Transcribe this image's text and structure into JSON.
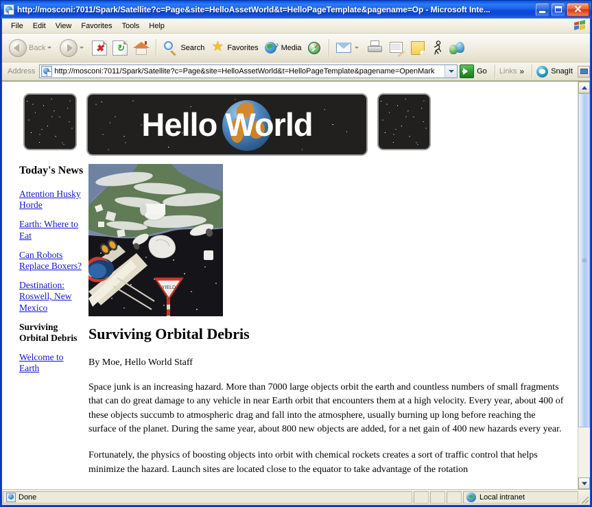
{
  "window": {
    "title": "http://mosconi:7011/Spark/Satellite?c=Page&site=HelloAssetWorld&t=HelloPageTemplate&pagename=Op - Microsoft Inte...",
    "minimize_label": "Minimize",
    "maximize_label": "Maximize",
    "close_label": "✕"
  },
  "menu": {
    "items": [
      {
        "label": "File"
      },
      {
        "label": "Edit"
      },
      {
        "label": "View"
      },
      {
        "label": "Favorites"
      },
      {
        "label": "Tools"
      },
      {
        "label": "Help"
      }
    ]
  },
  "toolbar": {
    "back_label": "Back",
    "forward_label": "",
    "stop_label": "",
    "refresh_label": "",
    "home_label": "",
    "search_label": "Search",
    "favorites_label": "Favorites",
    "media_label": "Media",
    "history_label": "",
    "mail_label": "",
    "print_label": "",
    "edit_label": "",
    "notes_label": "",
    "messenger_label": "",
    "discuss_label": ""
  },
  "address": {
    "label": "Address",
    "url": "http://mosconi:7011/Spark/Satellite?c=Page&site=HelloAssetWorld&t=HelloPageTemplate&pagename=OpenMark",
    "go_label": "Go",
    "links_label": "Links",
    "overflow_label": "»",
    "snagit_label": "SnagIt"
  },
  "banner": {
    "title": "Hello World"
  },
  "sidebar": {
    "heading": "Today's News",
    "items": [
      {
        "label": "Attention Husky Horde",
        "current": false
      },
      {
        "label": "Earth: Where to Eat",
        "current": false
      },
      {
        "label": "Can Robots Replace Boxers?",
        "current": false
      },
      {
        "label": "Destination: Roswell, New Mexico",
        "current": false
      },
      {
        "label": "Surviving Orbital Debris",
        "current": true
      },
      {
        "label": "Welcome to Earth",
        "current": false
      }
    ]
  },
  "article": {
    "image_alt": "orbital-debris-illustration",
    "title": "Surviving Orbital Debris",
    "byline": "By Moe, Hello World Staff",
    "paragraphs": [
      "Space junk is an increasing hazard. More than 7000 large objects orbit the earth and countless numbers of small fragments that can do great damage to any vehicle in near Earth orbit that encounters them at a high velocity. Every year, about 400 of these objects succumb to atmospheric drag and fall into the atmosphere, usually burning up long before reaching the surface of the planet. During the same year, about 800 new objects are added, for a net gain of 400 new hazards every year.",
      "Fortunately, the physics of boosting objects into orbit with chemical rockets creates a sort of traffic control that helps minimize the hazard. Launch sites are located close to the equator to take advantage of the rotation"
    ]
  },
  "statusbar": {
    "status": "Done",
    "zone": "Local intranet"
  },
  "colors": {
    "titlebar": "#0a46d2",
    "link": "#1414d2",
    "chrome": "#ece9d8",
    "page_bg": "#ffffff"
  }
}
